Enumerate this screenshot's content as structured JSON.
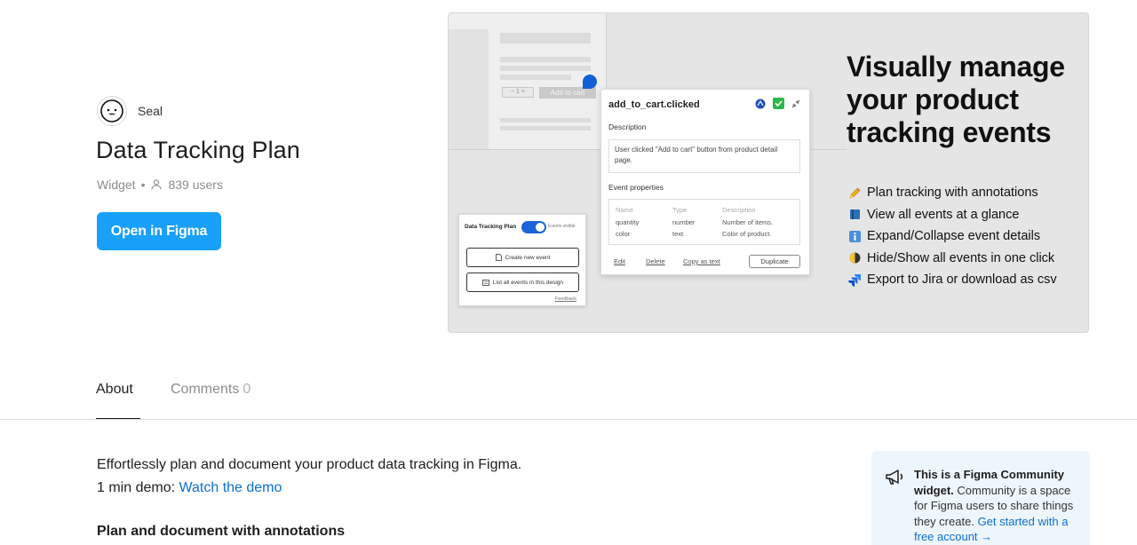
{
  "author": {
    "name": "Seal"
  },
  "title": "Data Tracking Plan",
  "meta": {
    "type": "Widget",
    "separator": "•",
    "users": "839 users"
  },
  "open_button": "Open in Figma",
  "hero": {
    "mock": {
      "stepper": "− 1 +",
      "add_to_cart": "Add to cart"
    },
    "event_card": {
      "name": "add_to_cart.clicked",
      "description_label": "Description",
      "description": "User clicked \"Add to cart\" button from product detail page.",
      "properties_label": "Event properties",
      "columns": [
        "Name",
        "Type",
        "Description"
      ],
      "rows": [
        [
          "quantity",
          "number",
          "Number of items."
        ],
        [
          "color",
          "text",
          "Color of product."
        ]
      ],
      "actions": {
        "edit": "Edit",
        "delete": "Delete",
        "copy": "Copy as text",
        "duplicate": "Duplicate"
      }
    },
    "plan_card": {
      "title": "Data Tracking Plan",
      "toggle_label": "Events visible",
      "create": "Create new event",
      "list": "List all events in this design",
      "feedback": "Feedback"
    },
    "headline": "Visually manage your product tracking events",
    "features": [
      {
        "icon": "pencil-icon",
        "text": "Plan tracking with annotations"
      },
      {
        "icon": "book-icon",
        "text": "View all events at a glance"
      },
      {
        "icon": "info-icon",
        "text": "Expand/Collapse event details"
      },
      {
        "icon": "half-moon-icon",
        "text": "Hide/Show all events in one click"
      },
      {
        "icon": "jira-icon",
        "text": "Export to Jira or download as csv"
      }
    ]
  },
  "tabs": {
    "about": "About",
    "comments": "Comments",
    "comments_count": "0"
  },
  "about": {
    "line1": "Effortlessly plan and document your product data tracking in Figma.",
    "demo_prefix": "1 min demo:",
    "demo_link": "Watch the demo",
    "section_heading": "Plan and document with annotations"
  },
  "community": {
    "bold": "This is a Figma Community widget.",
    "text": "Community is a space for Figma users to share things they create.",
    "link": "Get started with a free account →"
  },
  "colors": {
    "accent": "#18a0fb",
    "link": "#0d6fd1",
    "info_bg": "#eef6fd"
  }
}
